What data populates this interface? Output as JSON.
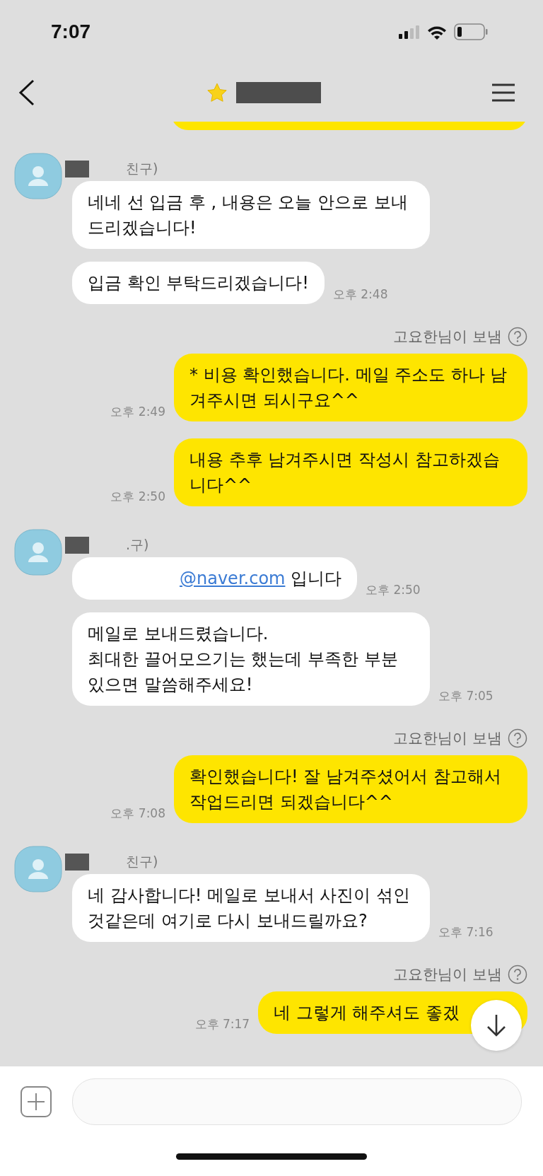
{
  "status_bar": {
    "time": "7:07"
  },
  "header": {
    "starred": true
  },
  "messages": [
    {
      "kind": "received",
      "sender": "친구)",
      "text": "네네 선 입금 후 , 내용은 오늘 안으로 보내드리겠습니다!"
    },
    {
      "kind": "received",
      "text": "입금 확인 부탁드리겠습니다!",
      "time": "오후 2:48"
    },
    {
      "kind": "sent",
      "sent_by": "고요한님이 보냄",
      "text": "* 비용 확인했습니다. 메일 주소도 하나 남겨주시면 되시구요^^",
      "time": "오후 2:49"
    },
    {
      "kind": "sent",
      "text": "내용 추후 남겨주시면 작성시 참고하겠습니다^^",
      "time": "오후 2:50"
    },
    {
      "kind": "received",
      "sender": ".구)",
      "link": "@naver.com",
      "text": "입니다",
      "time": "오후 2:50"
    },
    {
      "kind": "received",
      "text": "메일로 보내드렸습니다.\n최대한 끌어모으기는 했는데 부족한 부분 있으면 말씀해주세요!",
      "time": "오후 7:05"
    },
    {
      "kind": "sent",
      "sent_by": "고요한님이 보냄",
      "text": "확인했습니다! 잘 남겨주셨어서 참고해서 작업드리면 되겠습니다^^",
      "time": "오후 7:08"
    },
    {
      "kind": "received",
      "sender": "친구)",
      "text": "네 감사합니다! 메일로 보내서 사진이 섞인 것같은데 여기로 다시 보내드릴까요?",
      "time": "오후 7:16"
    },
    {
      "kind": "sent",
      "sent_by": "고요한님이 보냄",
      "text": "네 그렇게 해주셔도 좋겠",
      "time": "오후 7:17"
    }
  ]
}
